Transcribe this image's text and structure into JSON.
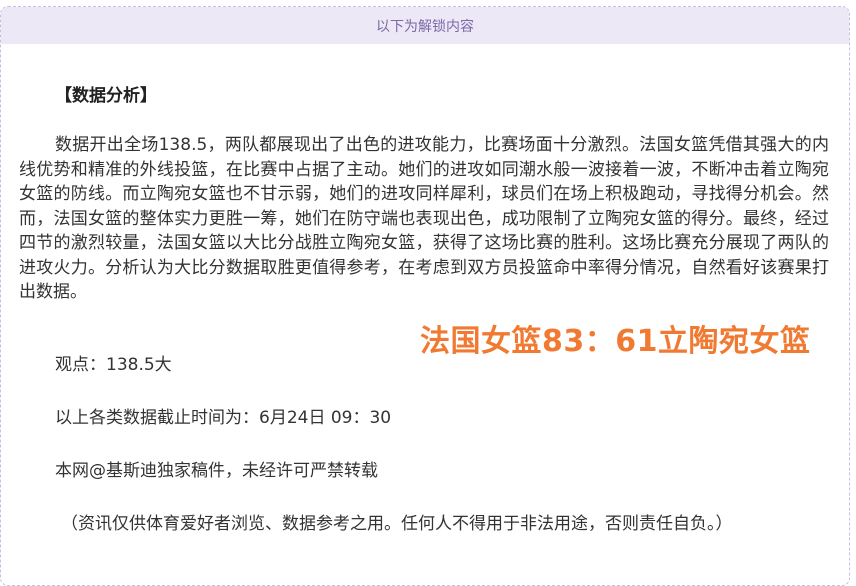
{
  "header": {
    "unlock_label": "以下为解锁内容"
  },
  "article": {
    "section_title": "【数据分析】",
    "analysis_paragraph": "数据开出全场138.5，两队都展现出了出色的进攻能力，比赛场面十分激烈。法国女篮凭借其强大的内线优势和精准的外线投篮，在比赛中占据了主动。她们的进攻如同潮水般一波接着一波，不断冲击着立陶宛女篮的防线。而立陶宛女篮也不甘示弱，她们的进攻同样犀利，球员们在场上积极跑动，寻找得分机会。然而，法国女篮的整体实力更胜一筹，她们在防守端也表现出色，成功限制了立陶宛女篮的得分。最终，经过四节的激烈较量，法国女篮以大比分战胜立陶宛女篮，获得了这场比赛的胜利。这场比赛充分展现了两队的进攻火力。分析认为大比分数据取胜更值得参考，在考虑到双方员投篮命中率得分情况，自然看好该赛果打出数据。",
    "viewpoint": "观点：138.5大",
    "cutoff_time": "以上各类数据截止时间为：6月24日 09：30",
    "copyright": "本网@基斯迪独家稿件，未经许可严禁转载",
    "disclaimer": "（资讯仅供体育爱好者浏览、数据参考之用。任何人不得用于非法用途，否则责任自负。）"
  },
  "overlay": {
    "score_text": "法国女篮83：61立陶宛女篮",
    "color": "#f07a32"
  }
}
